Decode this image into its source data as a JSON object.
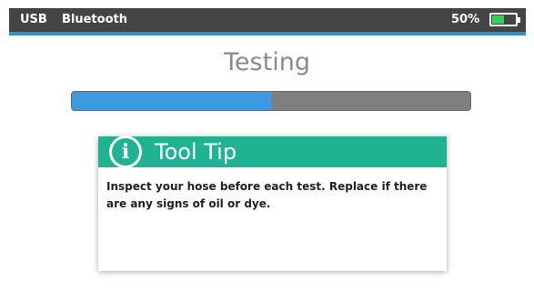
{
  "status_bar": {
    "usb_label": "USB",
    "bluetooth_label": "Bluetooth",
    "battery_percent_label": "50%",
    "battery_level": 0.5,
    "colors": {
      "bar_background": "#444444",
      "accent_line": "#2e8fc9",
      "battery_fill": "#2fd15a"
    }
  },
  "screen": {
    "title": "Testing",
    "progress": 0.5,
    "progress_colors": {
      "fill": "#3b9ae1",
      "track": "#7f7f7f"
    }
  },
  "tool_tip": {
    "icon": "info-icon",
    "icon_glyph": "i",
    "title": "Tool Tip",
    "body": "Inspect your hose before each test.  Replace if there are any signs of oil or dye.",
    "header_color": "#1fb394"
  }
}
